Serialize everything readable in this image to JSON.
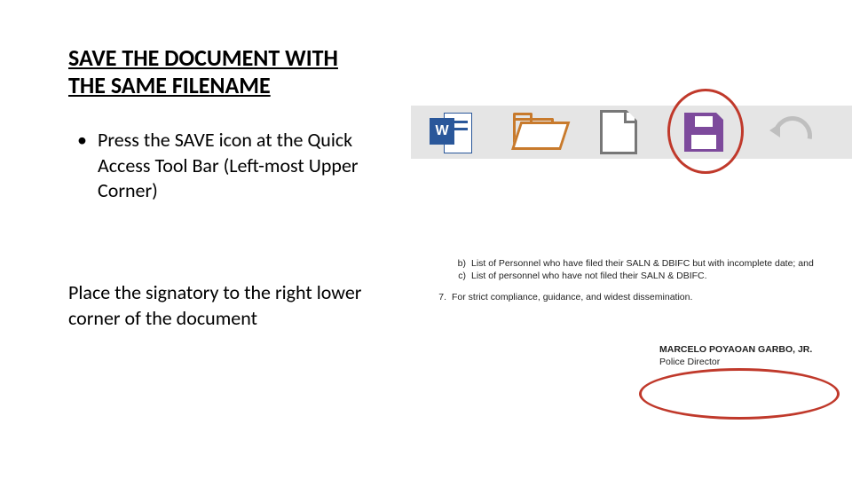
{
  "title": "SAVE THE DOCUMENT WITH THE SAME FILENAME",
  "bullet1": "Press the SAVE icon at the Quick Access Tool Bar (Left-most Upper Corner)",
  "para2": "Place the signatory to the right lower corner of the document",
  "toolbar": {
    "word_badge": "W"
  },
  "doc_excerpt": {
    "b_label": "b)",
    "b_text": "List of Personnel who have filed their SALN & DBIFC but with incomplete date; and",
    "c_label": "c)",
    "c_text": "List of personnel who have not filed their SALN & DBIFC.",
    "seven_label": "7.",
    "seven_text": "For strict compliance, guidance, and widest dissemination.",
    "sig_name": "MARCELO POYAOAN GARBO, JR.",
    "sig_title": "Police Director"
  }
}
